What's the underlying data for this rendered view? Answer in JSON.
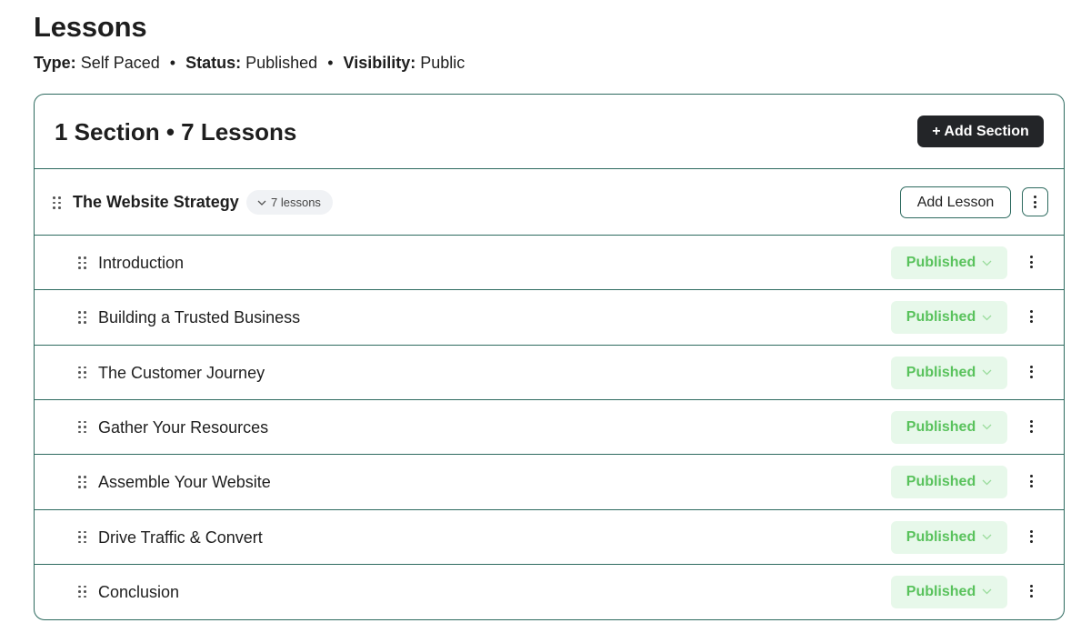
{
  "page": {
    "title": "Lessons",
    "meta": [
      {
        "label": "Type:",
        "value": "Self Paced"
      },
      {
        "label": "Status:",
        "value": "Published"
      },
      {
        "label": "Visibility:",
        "value": "Public"
      }
    ],
    "separator": "•"
  },
  "panel": {
    "heading": "1 Section • 7 Lessons",
    "add_section_label": "+ Add Section"
  },
  "section": {
    "title": "The Website Strategy",
    "lesson_count_label": "7 lessons",
    "add_lesson_label": "Add Lesson"
  },
  "lessons": [
    {
      "title": "Introduction",
      "status": "Published"
    },
    {
      "title": "Building a Trusted Business",
      "status": "Published"
    },
    {
      "title": "The Customer Journey",
      "status": "Published"
    },
    {
      "title": "Gather Your Resources",
      "status": "Published"
    },
    {
      "title": "Assemble Your Website",
      "status": "Published"
    },
    {
      "title": "Drive Traffic & Convert",
      "status": "Published"
    },
    {
      "title": "Conclusion",
      "status": "Published"
    }
  ],
  "colors": {
    "border": "#2d6a5f",
    "dark_button": "#232528",
    "published_bg": "#e7f8ea",
    "published_text": "#59c25c"
  },
  "icons": {
    "drag": "drag-handle-icon",
    "kebab": "more-vertical-icon",
    "chevron": "chevron-down-icon"
  }
}
